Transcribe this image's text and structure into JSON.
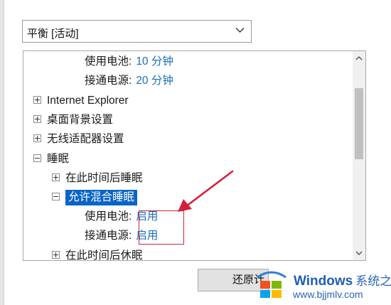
{
  "plan": {
    "selected": "平衡 [活动]"
  },
  "tree": [
    {
      "label": "使用电池:",
      "value": "10 分钟"
    },
    {
      "label": "接通电源:",
      "value": "20 分钟"
    },
    {
      "label": "Internet Explorer"
    },
    {
      "label": "桌面背景设置"
    },
    {
      "label": "无线适配器设置"
    },
    {
      "label": "睡眠"
    },
    {
      "label": "在此时间后睡眠"
    },
    {
      "label": "允许混合睡眠"
    },
    {
      "label": "使用电池:",
      "value": "启用"
    },
    {
      "label": "接通电源:",
      "value": "启用"
    },
    {
      "label": "在此时间后休眠"
    }
  ],
  "buttons": {
    "restore": "还原计划默认值"
  },
  "watermark": {
    "brand": "Windows",
    "brand_cn": "系统之家",
    "url": "www.bjjmlv.com"
  },
  "colors": {
    "selection": "#0a64c8",
    "value_text": "#1c6fb8",
    "annotation": "#c8283c"
  }
}
